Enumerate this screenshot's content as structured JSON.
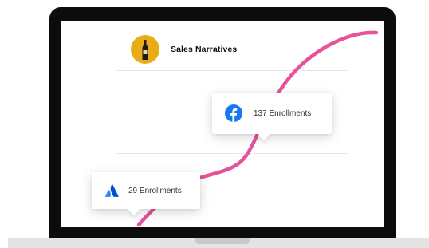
{
  "header": {
    "title": "Sales Narratives",
    "avatar_icon": "bottle-icon"
  },
  "cards": [
    {
      "company_icon": "facebook-icon",
      "label": "137 Enrollments",
      "icon_color": "#1877f2"
    },
    {
      "company_icon": "atlassian-icon",
      "label": "29 Enrollments",
      "icon_color": "#2684ff"
    }
  ],
  "colors": {
    "curve": "#e8519b",
    "avatar_bg": "#e8ad16",
    "bezel": "#0c0c0c"
  }
}
